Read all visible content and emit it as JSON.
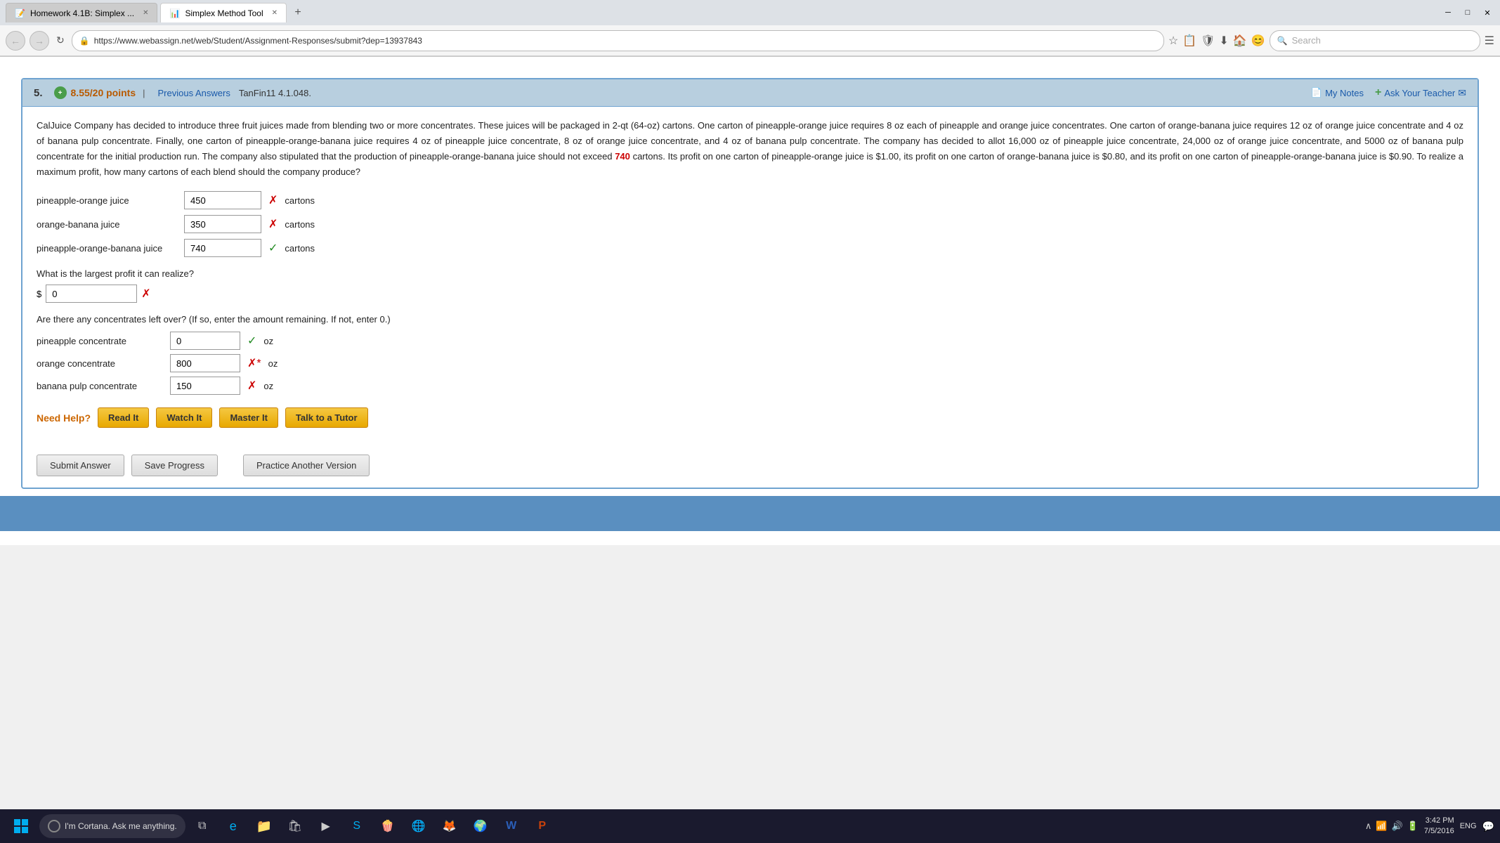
{
  "browser": {
    "tabs": [
      {
        "id": "tab1",
        "label": "Homework 4.1B: Simplex ...",
        "active": false,
        "favicon": "📝"
      },
      {
        "id": "tab2",
        "label": "Simplex Method Tool",
        "active": true,
        "favicon": "📊"
      }
    ],
    "new_tab_label": "+",
    "address": "https://www.webassign.net/web/Student/Assignment-Responses/submit?dep=13937843",
    "search_placeholder": "Search",
    "window_controls": {
      "minimize": "─",
      "maximize": "□",
      "close": "✕"
    }
  },
  "question": {
    "number": "5.",
    "points": "8.55/20 points",
    "separator": "|",
    "prev_answers_label": "Previous Answers",
    "source": "TanFin11 4.1.048.",
    "my_notes_label": "My Notes",
    "ask_teacher_label": "Ask Your Teacher",
    "problem_text_1": "CalJuice Company has decided to introduce three fruit juices made from blending two or more concentrates. These juices will be packaged in 2-qt (64-oz) cartons. One carton of pineapple-orange juice requires 8 oz each of pineapple and orange juice concentrates. One carton of orange-banana juice requires 12 oz of orange juice concentrate and 4 oz of banana pulp concentrate. Finally, one carton of pineapple-orange-banana juice requires 4 oz of pineapple juice concentrate, 8 oz of orange juice concentrate, and 4 oz of banana pulp concentrate. The company has decided to allot 16,000 oz of pineapple juice concentrate, 24,000 oz of orange juice concentrate, and 5000 oz of banana pulp concentrate for the initial production run. The company also stipulated that the production of pineapple-orange-banana juice should not exceed ",
    "highlight_number": "740",
    "problem_text_2": " cartons. Its profit on one carton of pineapple-orange juice is $1.00, its profit on one carton of orange-banana juice is $0.80, and its profit on one carton of pineapple-orange-banana juice is $0.90. To realize a maximum profit, how many cartons of each blend should the company produce?",
    "answers": [
      {
        "label": "pineapple-orange juice",
        "value": "450",
        "status": "wrong",
        "unit": "cartons"
      },
      {
        "label": "orange-banana juice",
        "value": "350",
        "status": "wrong",
        "unit": "cartons"
      },
      {
        "label": "pineapple-orange-banana juice",
        "value": "740",
        "status": "correct",
        "unit": "cartons"
      }
    ],
    "profit_question": "What is the largest profit it can realize?",
    "profit_dollar": "$",
    "profit_value": "0",
    "profit_status": "wrong",
    "concentrates_question": "Are there any concentrates left over? (If so, enter the amount remaining. If not, enter 0.)",
    "concentrates": [
      {
        "label": "pineapple concentrate",
        "value": "0",
        "status": "correct",
        "unit": "oz"
      },
      {
        "label": "orange concentrate",
        "value": "800",
        "status": "wrong_asterisk",
        "unit": "oz"
      },
      {
        "label": "banana pulp concentrate",
        "value": "150",
        "status": "wrong",
        "unit": "oz"
      }
    ],
    "need_help_label": "Need Help?",
    "help_buttons": [
      {
        "label": "Read It"
      },
      {
        "label": "Watch It"
      },
      {
        "label": "Master It"
      },
      {
        "label": "Talk to a Tutor"
      }
    ],
    "submit_label": "Submit Answer",
    "save_label": "Save Progress",
    "practice_label": "Practice Another Version"
  },
  "taskbar": {
    "cortana_text": "I'm Cortana. Ask me anything.",
    "time": "3:42 PM",
    "date": "7/5/2016",
    "lang": "ENG"
  }
}
